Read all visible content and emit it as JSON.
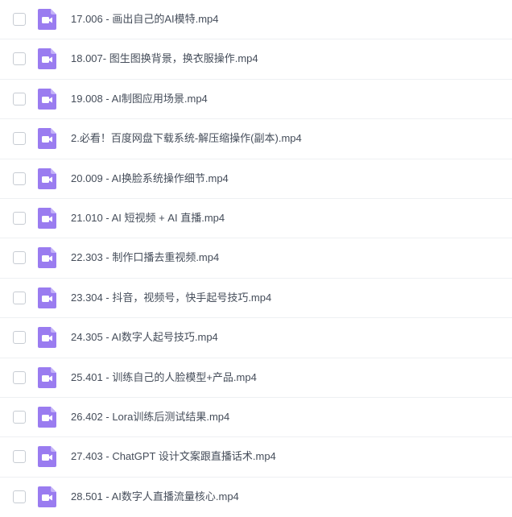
{
  "files": [
    {
      "name": "17.006 - 画出自己的AI模特.mp4",
      "icon": "video-file-icon"
    },
    {
      "name": "18.007- 图生图换背景，换衣服操作.mp4",
      "icon": "video-file-icon"
    },
    {
      "name": "19.008 - AI制图应用场景.mp4",
      "icon": "video-file-icon"
    },
    {
      "name": "2.必看！百度网盘下载系统-解压缩操作(副本).mp4",
      "icon": "video-file-icon"
    },
    {
      "name": "20.009 - AI换脸系统操作细节.mp4",
      "icon": "video-file-icon"
    },
    {
      "name": "21.010 - AI 短视频 + AI 直播.mp4",
      "icon": "video-file-icon"
    },
    {
      "name": "22.303 - 制作口播去重视频.mp4",
      "icon": "video-file-icon"
    },
    {
      "name": "23.304 - 抖音，视频号，快手起号技巧.mp4",
      "icon": "video-file-icon"
    },
    {
      "name": "24.305 - AI数字人起号技巧.mp4",
      "icon": "video-file-icon"
    },
    {
      "name": "25.401 - 训练自己的人脸模型+产品.mp4",
      "icon": "video-file-icon"
    },
    {
      "name": "26.402 - Lora训练后测试结果.mp4",
      "icon": "video-file-icon"
    },
    {
      "name": "27.403 - ChatGPT 设计文案跟直播话术.mp4",
      "icon": "video-file-icon"
    },
    {
      "name": "28.501 - AI数字人直播流量核心.mp4",
      "icon": "video-file-icon"
    }
  ],
  "colors": {
    "icon_purple": "#9a7cf0",
    "text": "#454d5a",
    "divider": "#eef0f3"
  }
}
